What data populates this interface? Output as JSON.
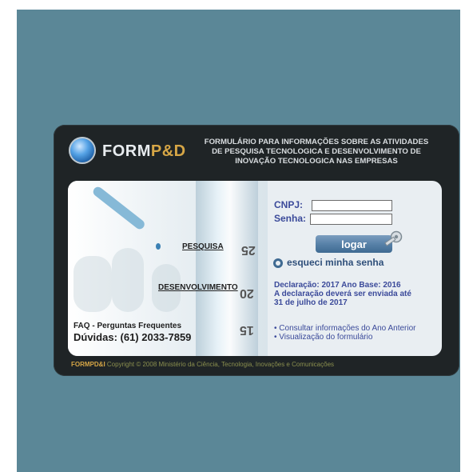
{
  "header": {
    "logo_text_main": "FORM",
    "logo_text_accent": "P&D",
    "title_line_1": "FORMULÁRIO PARA INFORMAÇÕES SOBRE AS ATIVIDADES",
    "title_line_2": "DE PESQUISA TECNOLOGICA E DESENVOLVIMENTO DE",
    "title_line_3": "INOVAÇÃO TECNOLOGICA NAS EMPRESAS"
  },
  "image_labels": {
    "pesquisa": "PESQUISA",
    "desenvolvimento": "DESENVOLVIMENTO",
    "num_25": "25",
    "num_20": "20",
    "num_15": "15"
  },
  "help": {
    "faq": "FAQ - Perguntas Frequentes",
    "duvidas": "Dúvidas: (61) 2033-7859"
  },
  "login": {
    "cnpj_label": "CNPJ:",
    "senha_label": "Senha:",
    "cnpj_value": "",
    "senha_value": "",
    "button_label": "logar",
    "forgot_label": "esqueci minha senha"
  },
  "declaration": {
    "line_1": "Declaração: 2017  Ano Base: 2016",
    "line_2": "A declaração deverá ser enviada até",
    "line_3": "31 de julho de 2017"
  },
  "links": [
    "• Consultar informações do Ano Anterior",
    "• Visualização do formulário"
  ],
  "footer": {
    "brand": "FORMPD&I",
    "text": " Copyright © 2008 Ministério da Ciência, Tecnologia, Inovações e Comunicações"
  }
}
